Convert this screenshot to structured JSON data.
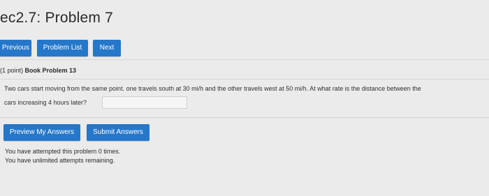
{
  "page": {
    "title": "ec2.7: Problem 7"
  },
  "nav": {
    "previous_label": "Previous",
    "problem_list_label": "Problem List",
    "next_label": "Next"
  },
  "problem": {
    "points": "(1 point)",
    "title": "Book Problem 13",
    "text_line1": "Two cars start moving from the same point. one travels south at 30 mi/h and the other travels west at 50 mi/h. At what rate is the distance between the",
    "text_line2": "cars increasing 4 hours later?",
    "answer_value": ""
  },
  "actions": {
    "preview_label": "Preview My Answers",
    "submit_label": "Submit Answers"
  },
  "status": {
    "attempts_line": "You have attempted this problem 0 times.",
    "remaining_line": "You have unlimited attempts remaining."
  }
}
